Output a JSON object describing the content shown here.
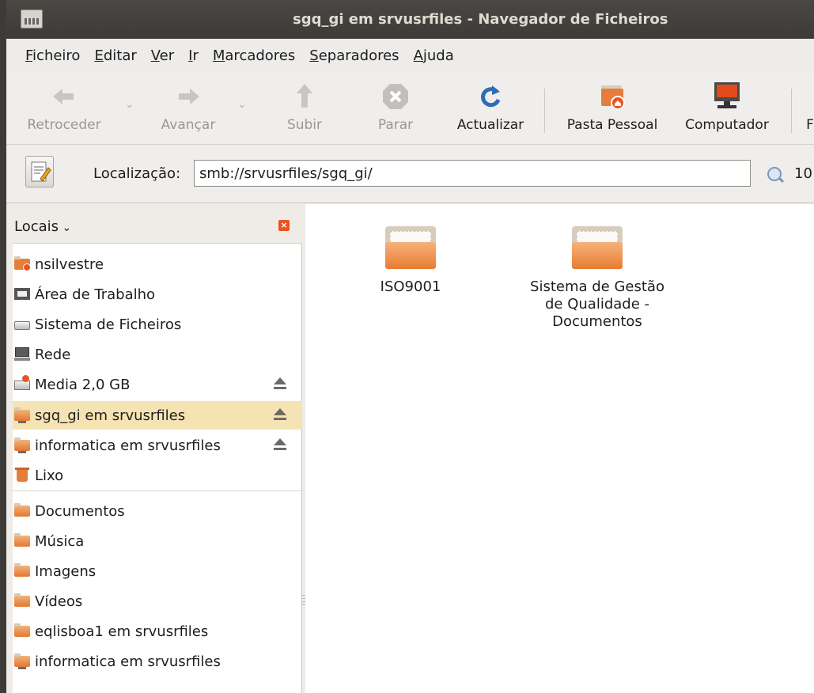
{
  "window": {
    "title": "sgq_gi em srvusrfiles - Navegador de Ficheiros"
  },
  "menu": [
    "Ficheiro",
    "Editar",
    "Ver",
    "Ir",
    "Marcadores",
    "Separadores",
    "Ajuda"
  ],
  "toolbar": {
    "back": "Retroceder",
    "forward": "Avançar",
    "up": "Subir",
    "stop": "Parar",
    "reload": "Actualizar",
    "home": "Pasta Pessoal",
    "computer": "Computador",
    "partial": "F"
  },
  "location": {
    "label": "Localização:",
    "value": "smb://srvusrfiles/sgq_gi/",
    "zoom": "10"
  },
  "sidebar": {
    "title": "Locais",
    "places": [
      {
        "label": "nsilvestre",
        "icon": "home-folder-icon"
      },
      {
        "label": "Área de Trabalho",
        "icon": "desktop-icon"
      },
      {
        "label": "Sistema de Ficheiros",
        "icon": "drive-icon"
      },
      {
        "label": "Rede",
        "icon": "network-icon"
      },
      {
        "label": "Media 2,0 GB",
        "icon": "media-icon"
      },
      {
        "label": "sgq_gi em srvusrfiles",
        "icon": "network-folder-icon"
      },
      {
        "label": "informatica em srvusrfiles",
        "icon": "network-folder-icon"
      },
      {
        "label": "Lixo",
        "icon": "trash-icon"
      }
    ],
    "bookmarks": [
      {
        "label": "Documentos",
        "icon": "folder-icon"
      },
      {
        "label": "Música",
        "icon": "folder-icon"
      },
      {
        "label": "Imagens",
        "icon": "folder-icon"
      },
      {
        "label": "Vídeos",
        "icon": "folder-icon"
      },
      {
        "label": "eqlisboa1 em srvusrfiles",
        "icon": "folder-icon"
      },
      {
        "label": "informatica em srvusrfiles",
        "icon": "network-folder-icon"
      }
    ]
  },
  "files": [
    {
      "name": "ISO9001"
    },
    {
      "name": "Sistema de Gestão de Qualidade - Documentos"
    }
  ],
  "colors": {
    "accent": "#e95420",
    "selection": "#f5e3b4",
    "folder": "#e67e3b"
  }
}
